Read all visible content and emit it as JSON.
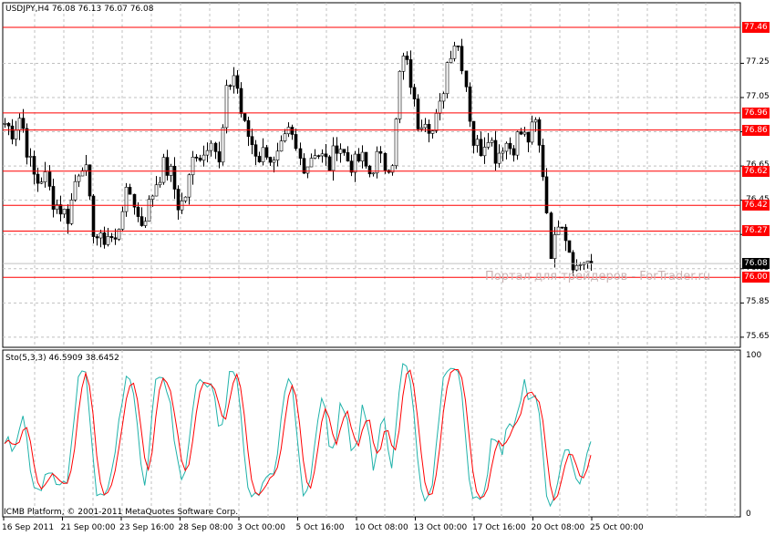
{
  "header": {
    "symbol_info": "USDJPY,H4  76.08 76.13 76.07 76.08"
  },
  "price_axis": {
    "min": 75.58,
    "max": 77.61,
    "ticks": [
      "77.25",
      "77.05",
      "76.85",
      "76.65",
      "76.45",
      "76.25",
      "76.05",
      "75.85",
      "75.65"
    ]
  },
  "levels": [
    {
      "value": 77.46,
      "label": "77.46"
    },
    {
      "value": 76.96,
      "label": "76.96"
    },
    {
      "value": 76.86,
      "label": "76.86"
    },
    {
      "value": 76.62,
      "label": "76.62"
    },
    {
      "value": 76.42,
      "label": "76.42"
    },
    {
      "value": 76.27,
      "label": "76.27"
    },
    {
      "value": 76.0,
      "label": "76.00"
    }
  ],
  "current_price": {
    "value": 76.08,
    "label": "76.08"
  },
  "watermark": "Портал для трейдеров - ForTrader.ru",
  "price_path": [
    76.9,
    76.85,
    76.95,
    76.7,
    76.55,
    76.6,
    76.45,
    76.4,
    76.35,
    76.6,
    76.7,
    76.3,
    76.2,
    76.25,
    76.2,
    76.45,
    76.5,
    76.3,
    76.4,
    76.55,
    76.65,
    76.6,
    76.4,
    76.5,
    76.75,
    76.7,
    76.85,
    76.65,
    77.1,
    77.2,
    76.9,
    76.8,
    76.7,
    76.75,
    76.65,
    76.75,
    76.85,
    76.7,
    76.65,
    76.75,
    76.7,
    76.65,
    76.8,
    76.7,
    76.65,
    76.7,
    76.6,
    76.7,
    76.65,
    76.7,
    77.3,
    77.2,
    76.9,
    76.95,
    76.85,
    77.0,
    77.3,
    77.4,
    77.2,
    76.8,
    76.75,
    76.85,
    76.7,
    76.8,
    76.75,
    76.85,
    76.8,
    76.9,
    76.6,
    76.1,
    76.4,
    76.2,
    76.05,
    76.1,
    76.08
  ],
  "indicator": {
    "title": "Sto(5,3,3) 46.5909 38.6452",
    "max_label": "100",
    "min_label": "0",
    "main_color": "#20b2aa",
    "signal_color": "#ff0000"
  },
  "footer": {
    "copyright": "ICMB Platform, © 2001-2011 MetaQuotes Software Corp."
  },
  "time_axis": [
    "16 Sep 2011",
    "21 Sep 00:00",
    "23 Sep 16:00",
    "28 Sep 08:00",
    "3 Oct 00:00",
    "5 Oct 16:00",
    "10 Oct 08:00",
    "13 Oct 00:00",
    "17 Oct 16:00",
    "20 Oct 08:00",
    "25 Oct 00:00"
  ]
}
